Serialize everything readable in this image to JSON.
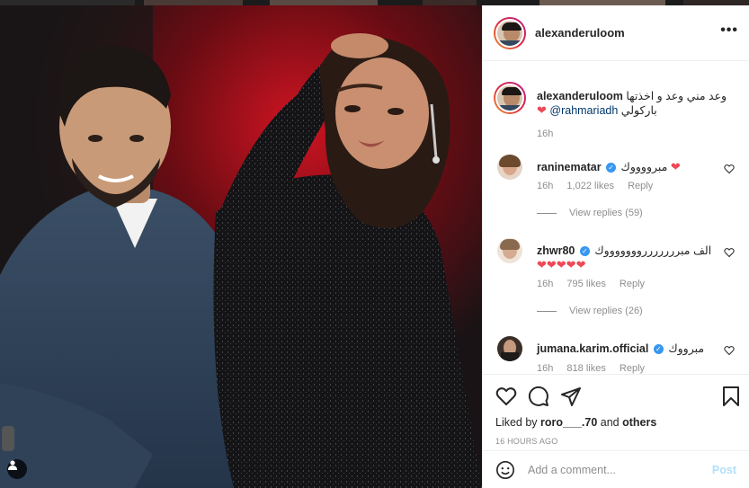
{
  "post": {
    "author": "alexanderuloom",
    "more_icon": "more-horizontal-icon",
    "caption": {
      "username": "alexanderuloom",
      "text": "وعد مني وعد و اخذتها",
      "mention": "@rahmariadh",
      "text_after": "باركولي",
      "time": "16h"
    }
  },
  "comments": [
    {
      "username": "raninematar",
      "verified": true,
      "text": "مبرووووك",
      "hearts": "❤",
      "time": "16h",
      "likes": "1,022 likes",
      "reply_label": "Reply",
      "view_replies": "View replies (59)"
    },
    {
      "username": "zhwr80",
      "verified": true,
      "text": "الف مبررررررروووووووك",
      "hearts": "❤❤❤❤❤",
      "time": "16h",
      "likes": "795 likes",
      "reply_label": "Reply",
      "view_replies": "View replies (26)"
    },
    {
      "username": "jumana.karim.official",
      "verified": true,
      "text": "مبرووك",
      "time": "16h",
      "likes": "818 likes",
      "reply_label": "Reply"
    }
  ],
  "actions": {
    "like_icon": "heart-icon",
    "comment_icon": "comment-icon",
    "share_icon": "paper-plane-icon",
    "save_icon": "bookmark-icon",
    "liked_by_prefix": "Liked by",
    "liked_by_user": "roro___.70",
    "liked_by_and": "and",
    "liked_by_others": "others",
    "time_ago": "16 HOURS AGO"
  },
  "add_comment": {
    "emoji_icon": "emoji-icon",
    "placeholder": "Add a comment...",
    "post_label": "Post"
  },
  "colors": {
    "accent_blue": "#3897f0",
    "heart_red": "#ed4956",
    "post_disabled": "#b2dffc",
    "backdrop_red": "#c0121f"
  }
}
